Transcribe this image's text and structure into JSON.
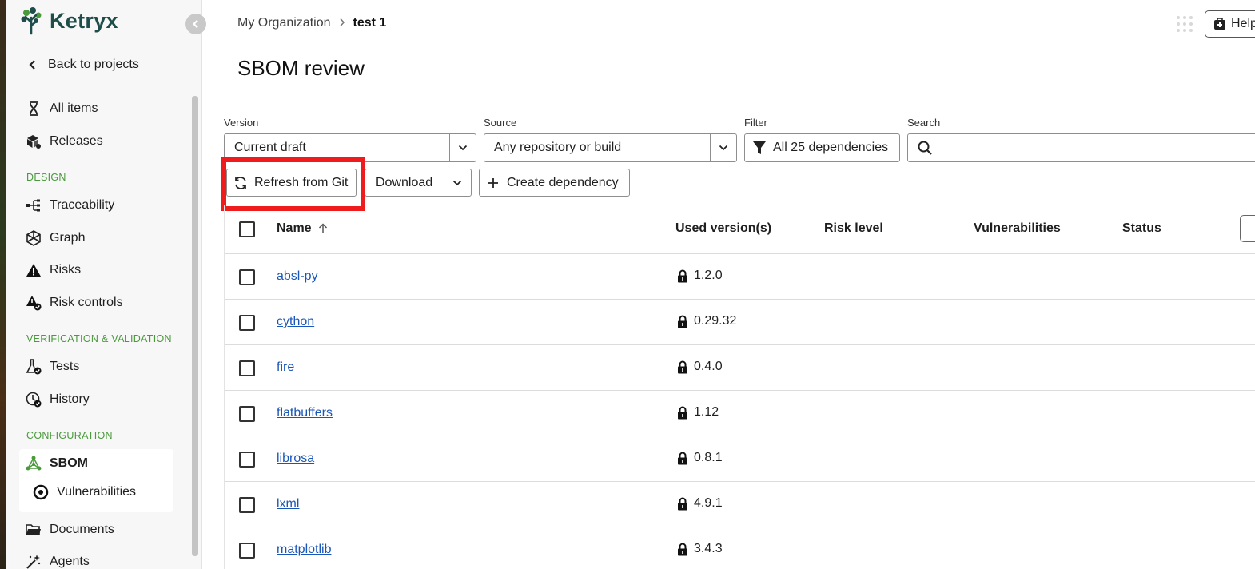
{
  "sidebar": {
    "logo_text": "Ketryx",
    "back_label": "Back to projects",
    "items": [
      {
        "label": "All items",
        "icon": "dna-icon"
      },
      {
        "label": "Releases",
        "icon": "boxes-icon"
      }
    ],
    "sections": [
      {
        "title": "DESIGN",
        "items": [
          {
            "label": "Traceability",
            "icon": "trace-icon"
          },
          {
            "label": "Graph",
            "icon": "graph-icon"
          },
          {
            "label": "Risks",
            "icon": "warning-icon"
          },
          {
            "label": "Risk controls",
            "icon": "risk-control-icon"
          }
        ]
      },
      {
        "title": "VERIFICATION & VALIDATION",
        "items": [
          {
            "label": "Tests",
            "icon": "flask-icon"
          },
          {
            "label": "History",
            "icon": "history-icon"
          }
        ]
      },
      {
        "title": "CONFIGURATION",
        "items": [
          {
            "label": "SBOM",
            "icon": "sbom-icon",
            "active": true
          },
          {
            "label": "Vulnerabilities",
            "icon": "target-icon"
          },
          {
            "label": "Documents",
            "icon": "folder-icon"
          },
          {
            "label": "Agents",
            "icon": "magic-wand-icon"
          }
        ]
      }
    ]
  },
  "breadcrumb": {
    "parent": "My Organization",
    "current": "test 1"
  },
  "header": {
    "help_label": "Help"
  },
  "page": {
    "title": "SBOM review"
  },
  "filters": {
    "version_label": "Version",
    "version_value": "Current draft",
    "source_label": "Source",
    "source_value": "Any repository or build",
    "filter_label": "Filter",
    "filter_value": "All 25 dependencies",
    "search_label": "Search",
    "search_placeholder": ""
  },
  "actions": {
    "refresh_label": "Refresh from Git",
    "download_label": "Download",
    "create_label": "Create dependency"
  },
  "table": {
    "columns": [
      "Name",
      "Used version(s)",
      "Risk level",
      "Vulnerabilities",
      "Status"
    ],
    "rows": [
      {
        "name": "absl-py",
        "version": "1.2.0"
      },
      {
        "name": "cython",
        "version": "0.29.32"
      },
      {
        "name": "fire",
        "version": "0.4.0"
      },
      {
        "name": "flatbuffers",
        "version": "1.12"
      },
      {
        "name": "librosa",
        "version": "0.8.1"
      },
      {
        "name": "lxml",
        "version": "4.9.1"
      },
      {
        "name": "matplotlib",
        "version": "3.4.3"
      }
    ]
  },
  "colors": {
    "brand": "#1e4d4a",
    "section_heading": "#4a9a3c",
    "link": "#1a56b8",
    "highlight": "#ee1c1c"
  }
}
